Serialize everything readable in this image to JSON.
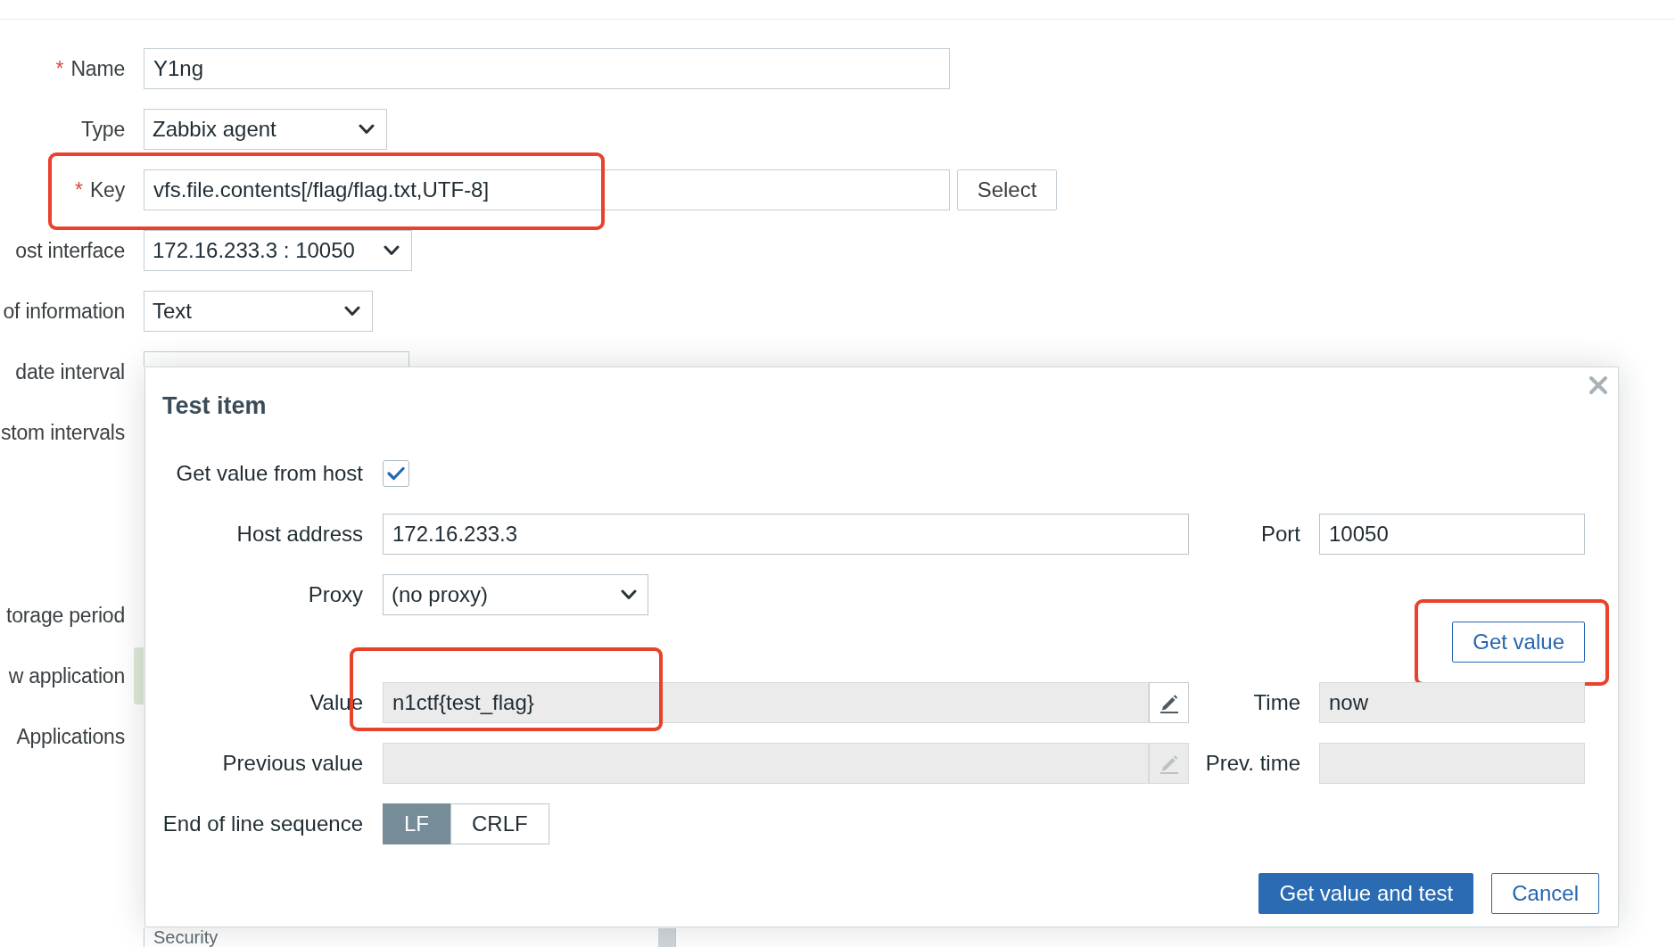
{
  "form": {
    "fields": [
      {
        "kind": "text",
        "required_mark": "*",
        "label": "Name",
        "value": "Y1ng",
        "highlighted": false,
        "marker": false
      },
      {
        "kind": "select",
        "label": "Type",
        "value": "Zabbix agent",
        "highlighted": false,
        "marker": false
      },
      {
        "kind": "text",
        "required_mark": "*",
        "label": "Key",
        "value": "vfs.file.contents[/flag/flag.txt,UTF-8]",
        "button": "Select",
        "highlighted": true,
        "marker": false
      },
      {
        "kind": "select",
        "label": "ost interface",
        "value": "172.16.233.3 : 10050",
        "highlighted": false,
        "marker": false
      },
      {
        "kind": "select",
        "label": "of information",
        "value": "Text",
        "highlighted": false,
        "marker": false
      },
      {
        "kind": "covered-field",
        "label": "date interval",
        "highlighted": false,
        "marker": false
      },
      {
        "kind": "covered",
        "label": "stom intervals",
        "highlighted": false,
        "marker": false
      },
      {
        "kind": "covered",
        "label": "torage period",
        "highlighted": false,
        "marker": false
      },
      {
        "kind": "covered",
        "label": "w application",
        "highlighted": false,
        "marker": true
      },
      {
        "kind": "listbox",
        "label": "Applications",
        "items": [
          "Security"
        ],
        "highlighted": false,
        "marker": false
      }
    ]
  },
  "test_dialog": {
    "title": "Test item",
    "get_value_from_host": {
      "label": "Get value from host",
      "checked": true
    },
    "host_address": {
      "label": "Host address",
      "value": "172.16.233.3",
      "readonly": false
    },
    "port": {
      "label": "Port",
      "value": "10050",
      "readonly": false
    },
    "proxy": {
      "label": "Proxy",
      "value": "(no proxy)"
    },
    "get_value_button": {
      "label": "Get value",
      "highlighted": true
    },
    "value": {
      "label": "Value",
      "value": "n1ctf{test_flag}",
      "readonly": true,
      "edit_disabled": false,
      "highlighted": true
    },
    "time": {
      "label": "Time",
      "value": "now",
      "readonly": true
    },
    "previous_value": {
      "label": "Previous value",
      "readonly": true,
      "edit_disabled": true,
      "highlighted": false
    },
    "prev_time": {
      "label": "Prev. time",
      "readonly": true
    },
    "end_of_line_sequence": {
      "label": "End of line sequence",
      "options": [
        {
          "label": "LF",
          "selected": true
        },
        {
          "label": "CRLF",
          "selected": false
        }
      ]
    },
    "buttons": [
      {
        "kind": "primary",
        "label": "Get value and test"
      },
      {
        "kind": "secondary",
        "label": "Cancel"
      }
    ]
  }
}
